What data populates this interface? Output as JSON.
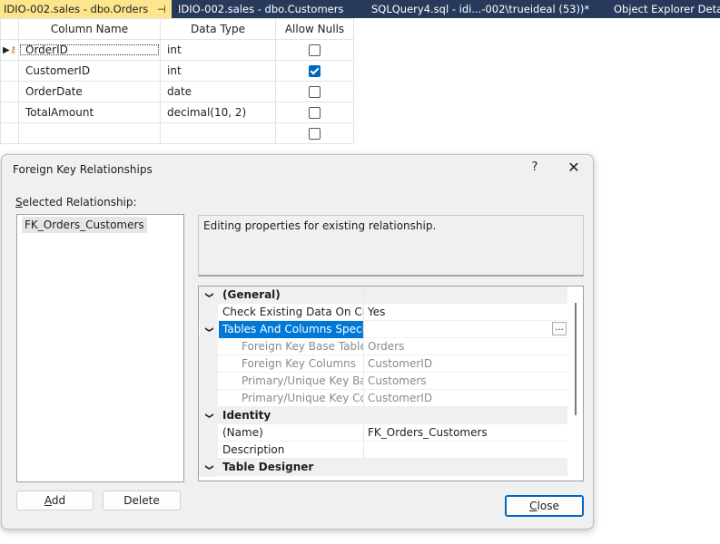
{
  "tabs": [
    {
      "label": "IDIO-002.sales - dbo.Orders",
      "pin": "⊣",
      "close": "✕"
    },
    {
      "label": "IDIO-002.sales - dbo.Customers"
    },
    {
      "label": "SQLQuery4.sql - idi...-002\\trueideal (53))*"
    },
    {
      "label": "Object Explorer Details"
    }
  ],
  "grid": {
    "headers": {
      "column_name": "Column Name",
      "data_type": "Data Type",
      "allow_nulls": "Allow Nulls"
    },
    "rows": [
      {
        "name": "OrderID",
        "type": "int",
        "allow_nulls": false,
        "primary_key": true
      },
      {
        "name": "CustomerID",
        "type": "int",
        "allow_nulls": true
      },
      {
        "name": "OrderDate",
        "type": "date",
        "allow_nulls": false
      },
      {
        "name": "TotalAmount",
        "type": "decimal(10, 2)",
        "allow_nulls": false
      },
      {
        "name": "",
        "type": "",
        "allow_nulls": false
      }
    ]
  },
  "dialog": {
    "title": "Foreign Key Relationships",
    "help": "?",
    "close_icon": "✕",
    "selected_label": "Selected Relationship:",
    "selected_label_mnemonic": "S",
    "selected_label_rest": "elected Relationship:",
    "relationships": [
      "FK_Orders_Customers"
    ],
    "description": "Editing properties for existing relationship.",
    "properties": {
      "general": "(General)",
      "check_existing_name": "Check Existing Data On Creat",
      "check_existing_value": "Yes",
      "tables_columns_spec": "Tables And Columns Specifica",
      "ellipsis": "...",
      "fk_base_table_name": "Foreign Key Base Table",
      "fk_base_table_value": "Orders",
      "fk_columns_name": "Foreign Key Columns",
      "fk_columns_value": "CustomerID",
      "pk_base_name": "Primary/Unique Key Base",
      "pk_base_value": "Customers",
      "pk_columns_name": "Primary/Unique Key Colu",
      "pk_columns_value": "CustomerID",
      "identity": "Identity",
      "name_name": "(Name)",
      "name_value": "FK_Orders_Customers",
      "description_name": "Description",
      "description_value": "",
      "table_designer": "Table Designer"
    },
    "buttons": {
      "add_mn": "A",
      "add_rest": "dd",
      "delete": "Delete",
      "close_mn": "C",
      "close_rest": "lose"
    }
  }
}
